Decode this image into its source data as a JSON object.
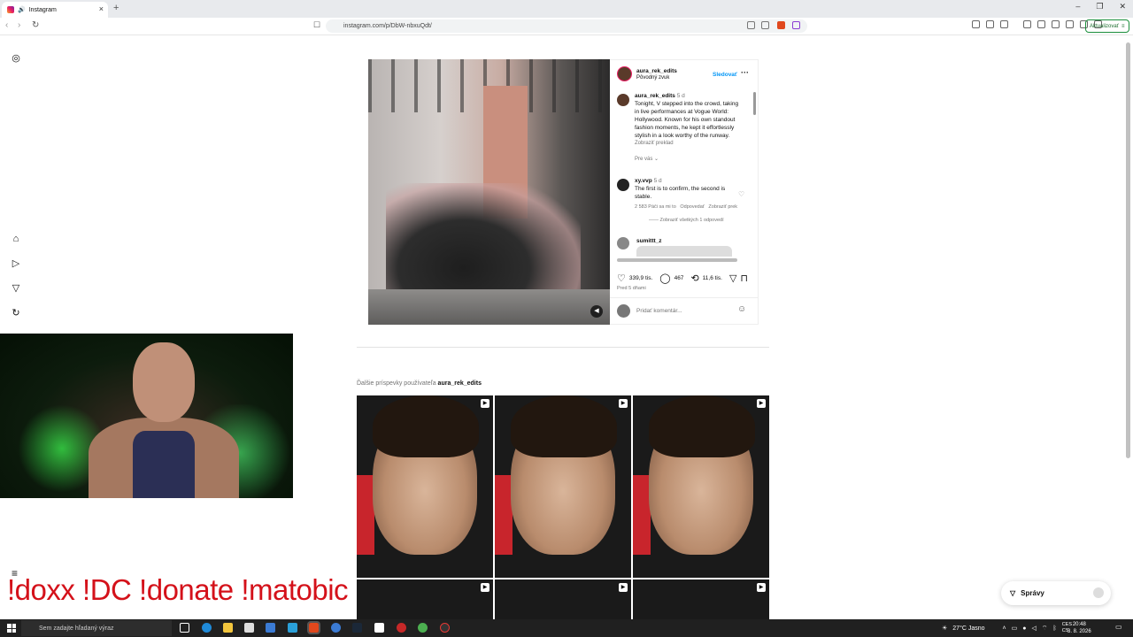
{
  "browser": {
    "tab_title": "Instagram",
    "url": "instagram.com/p/DbW-nbxuQdt/",
    "update_label": "Aktualizovať"
  },
  "post": {
    "username": "aura_rek_edits",
    "audio": "Pôvodný zvuk",
    "follow_label": "Sledovať",
    "caption_user": "aura_rek_edits",
    "caption_age": "5 d",
    "caption_text": "Tonight, V stepped into the crowd, taking in live performances at Vogue World: Hollywood. Known for his own standout fashion moments, he kept it effortlessly stylish in a look worthy of the runway.",
    "translate_label": "Zobraziť preklad",
    "for_you_label": "Pre vás",
    "comments": [
      {
        "user": "xy.vvp",
        "age": "5 d",
        "text": "The first is to confirm, the second is stable.",
        "likes": "2 583 Páči sa mi to",
        "reply_label": "Odpovedať",
        "translate_label": "Zobraziť prek",
        "view_replies": "Zobraziť všetkých 1 odpovedí"
      },
      {
        "user": "sumittt_z"
      }
    ],
    "likes": "339,9 tis.",
    "comment_count": "467",
    "reposts": "11,6 tis.",
    "time_ago": "Pred 5 dňami",
    "add_comment_placeholder": "Pridať komentár..."
  },
  "more_posts": {
    "prefix": "Ďalšie príspevky používateľa",
    "username": "aura_rek_edits"
  },
  "overlay": {
    "commands": "!doxx  !DC !donate !matobic"
  },
  "messages_label": "Správy",
  "taskbar": {
    "search_placeholder": "Sem zadajte hľadaný výraz",
    "weather": "27°C  Jasno",
    "lang": "CES\nCS",
    "time": "20:48",
    "date": "3. 8. 2026"
  }
}
